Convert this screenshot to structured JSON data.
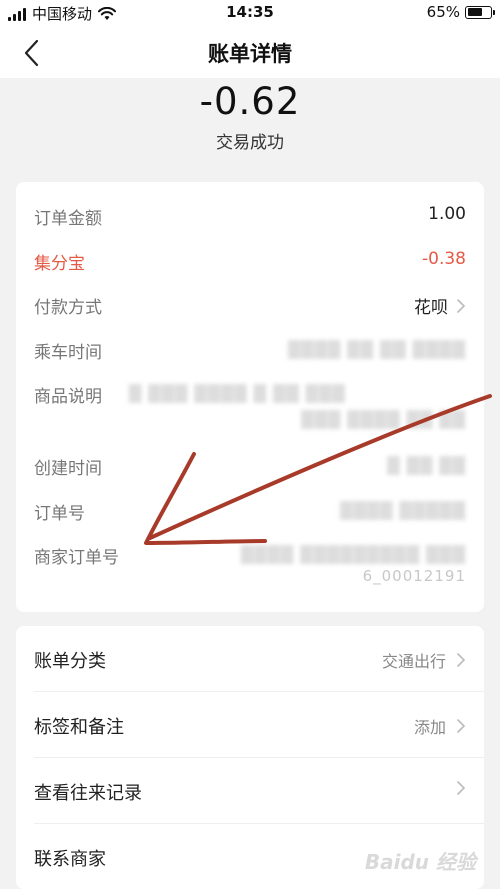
{
  "status_bar": {
    "carrier": "中国移动",
    "time": "14:35",
    "battery_percent": "65%",
    "battery_level": 0.65
  },
  "nav": {
    "title": "账单详情"
  },
  "summary": {
    "amount": "-0.62",
    "status": "交易成功"
  },
  "details": {
    "order_amount": {
      "label": "订单金额",
      "value": "1.00"
    },
    "jifenbao": {
      "label": "集分宝",
      "value": "-0.38"
    },
    "payment_method": {
      "label": "付款方式",
      "value": "花呗"
    },
    "ride_time": {
      "label": "乘车时间"
    },
    "product_desc": {
      "label": "商品说明"
    },
    "created_time": {
      "label": "创建时间"
    },
    "order_no": {
      "label": "订单号"
    },
    "merchant_order_no": {
      "label": "商家订单号",
      "visible_fragment": "6_00012191"
    }
  },
  "menu": {
    "bill_category": {
      "label": "账单分类",
      "value": "交通出行"
    },
    "tags_notes": {
      "label": "标签和备注",
      "value": "添加"
    },
    "history": {
      "label": "查看往来记录"
    },
    "contact_merchant": {
      "label": "联系商家"
    }
  },
  "watermark": "Baidu 经验",
  "colors": {
    "accent_red": "#e55a46",
    "annotation_stroke": "#a83a2a",
    "background": "#f2f2f2"
  }
}
